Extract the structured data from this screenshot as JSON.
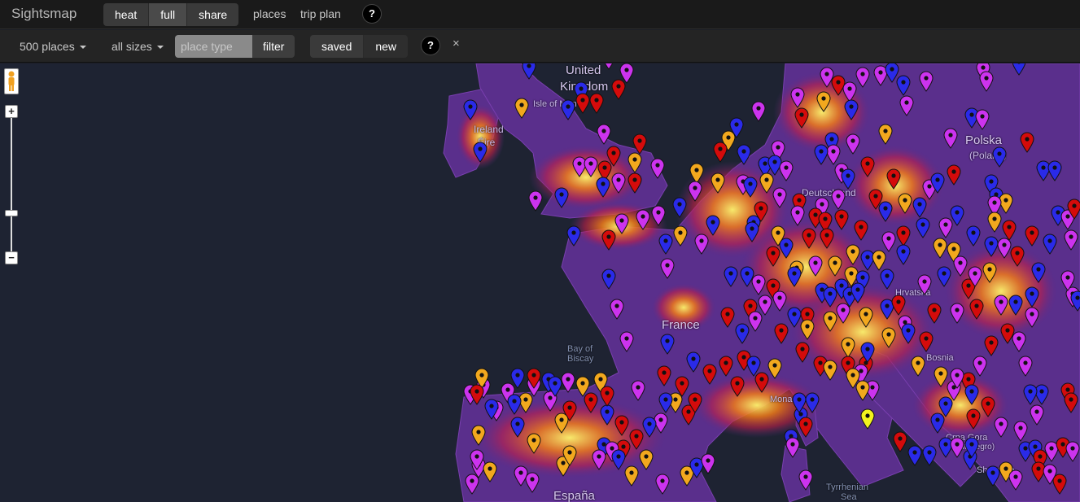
{
  "app": {
    "title": "Sightsmap"
  },
  "view_modes": [
    {
      "label": "heat",
      "active": false
    },
    {
      "label": "full",
      "active": true
    },
    {
      "label": "share",
      "active": false
    }
  ],
  "nav": {
    "places": "places",
    "trip_plan": "trip plan",
    "help": "?"
  },
  "filters": {
    "count_label": "500 places",
    "size_label": "all sizes",
    "type_placeholder": "place type",
    "filter_label": "filter",
    "saved_label": "saved",
    "new_label": "new",
    "help": "?",
    "close": "×"
  },
  "map": {
    "zoom_in": "+",
    "zoom_out": "−",
    "labels": {
      "uk1": "United",
      "uk2": "Kingdom",
      "isle": "Isle of Man",
      "ireland": "Ireland",
      "eire": "Éire",
      "poland": "Polska",
      "poland2": "(Poland)",
      "france": "France",
      "biscay1": "Bay of",
      "biscay2": "Biscay",
      "montenegro1": "Crna Gora",
      "montenegro2": "(Montenegro)",
      "albania": "Shqipëria",
      "tyrrhenian1": "Tyrrhenian",
      "tyrrhenian2": "Sea",
      "spain": "España",
      "germany": "Deutschland",
      "monaco": "Monaco",
      "bosnia": "Bosnia",
      "croatia": "Hrvatska"
    },
    "pin_colors": {
      "red": "#d40b0b",
      "blue": "#2a2ae8",
      "magenta": "#cc33ee",
      "orange": "#f2a81e",
      "yellow": "#f2f21e"
    }
  }
}
